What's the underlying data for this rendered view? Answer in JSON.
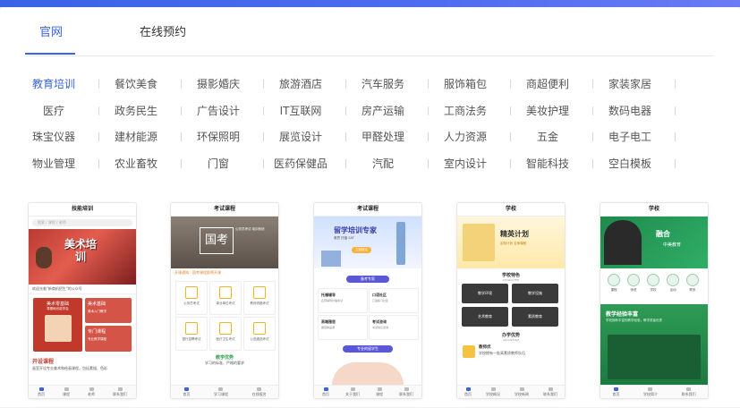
{
  "tabs": [
    "官网",
    "在线预约"
  ],
  "active_tab": "官网",
  "categories": [
    [
      "教育培训",
      "餐饮美食",
      "摄影婚庆",
      "旅游酒店",
      "汽车服务",
      "服饰箱包",
      "商超便利",
      "家装家居"
    ],
    [
      "医疗",
      "政务民生",
      "广告设计",
      "IT互联网",
      "房产运输",
      "工商法务",
      "美妆护理",
      "数码电器"
    ],
    [
      "珠宝仪器",
      "建材能源",
      "环保照明",
      "展览设计",
      "甲醛处理",
      "人力资源",
      "五金",
      "电子电工"
    ],
    [
      "物业管理",
      "农业畜牧",
      "门窗",
      "医药保健品",
      "汽配",
      "室内设计",
      "智能科技",
      "空白模板"
    ]
  ],
  "active_category": "教育培训",
  "cards": [
    {
      "title": "技能培训",
      "search": "搜索 / 课程 / 老师",
      "banner_text": "美术培训",
      "notice": "欢迎光临\"新商机招生\"的公众号",
      "item1_title": "美术零基础",
      "item1_sub": "零基础也能学会",
      "item2_title": "美术基础",
      "item2_sub": "美术入门教学",
      "item3_title": "专门课程",
      "item3_sub": "专业教学课程",
      "section": "开设课程",
      "section_text": "画室开设专业美术和绘画课程，包括素描、色彩",
      "nav": [
        "首页",
        "课程",
        "老师",
        "联系我们"
      ]
    },
    {
      "title": "考试课程",
      "banner_text": "国考",
      "banner_sub": "公务员考试 培训系统",
      "notice": "开课通知：国考课程即将开课",
      "buttons": [
        "公务员考试",
        "事业单位考试",
        "教师资格考试",
        "银行招聘考试",
        "医疗卫生考试",
        "公选遴选考试"
      ],
      "section": "教学优势",
      "section_text": "学习的标准、严格的要求",
      "nav": [
        "首页",
        "学习课程",
        "在线报名"
      ]
    },
    {
      "title": "考试课程",
      "banner_text": "留学培训专家",
      "banner_tags": "雅思 托福 SAT",
      "banner_btn": "立即报名",
      "pill1": "备考专家",
      "items": [
        {
          "t": "托福辅导",
          "s": "名师辅导托福考试"
        },
        {
          "t": "口语社区",
          "s": "口语练习社区"
        },
        {
          "t": "高端雅思",
          "s": "雅思精品课"
        },
        {
          "t": "考试咨询",
          "s": "考试信息咨询"
        }
      ],
      "pill2": "专业的留学生",
      "nav": [
        "首页",
        "关于我们",
        "课程",
        "联系我们"
      ]
    },
    {
      "title": "学校",
      "banner_text": "精英计划",
      "banner_sub": "定制计划 名师课程",
      "section1": "学校特色",
      "section1_en": "CHARACTER",
      "tiles": [
        "教学环境",
        "教学设施",
        "艺术教育",
        "素质教育"
      ],
      "section2": "办学优势",
      "section2_en": "ADVANTAGE",
      "item_title": "教师优",
      "item_text": "学校拥有一批高素质教师队伍",
      "nav": [
        "首页",
        "学校概况",
        "学校新闻",
        "联系我们"
      ]
    },
    {
      "title": "学校",
      "banner_text": "融合",
      "banner_sub": "中美教育",
      "icons": [
        "课程",
        "师资",
        "学校",
        "活动",
        "联系"
      ],
      "section": "教学经验丰富",
      "section_text": "学校拥有丰富的教学经验，教学质量优秀",
      "nav": [
        "首页",
        "学校简介",
        "联系我们"
      ]
    }
  ]
}
